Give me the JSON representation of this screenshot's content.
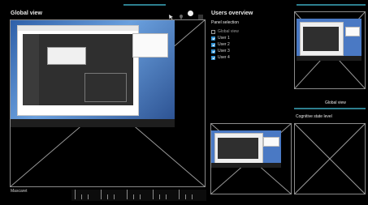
{
  "left_panel": {
    "title": "Global view",
    "icons": [
      "cursor-icon",
      "pin-icon",
      "dot-icon",
      "menu-icon"
    ]
  },
  "screen_image": {
    "description_label": "Global view screenshot"
  },
  "footer": {
    "mascaret_label": "Mascaret"
  },
  "right_panel": {
    "title": "Users overview",
    "panel_selection_label": "Panel selection",
    "items": [
      {
        "label": "Global view",
        "checked": false,
        "dim": true
      },
      {
        "label": "User 1",
        "checked": true,
        "dim": false
      },
      {
        "label": "User 2",
        "checked": true,
        "dim": false
      },
      {
        "label": "User 3",
        "checked": true,
        "dim": false
      },
      {
        "label": "User 4",
        "checked": true,
        "dim": false
      }
    ],
    "thumb_label": "Global view",
    "cognitive_label": "Cognitive state level"
  },
  "colors": {
    "accent": "#2d7f8f",
    "checkbox_blue": "#2f8fd0"
  }
}
